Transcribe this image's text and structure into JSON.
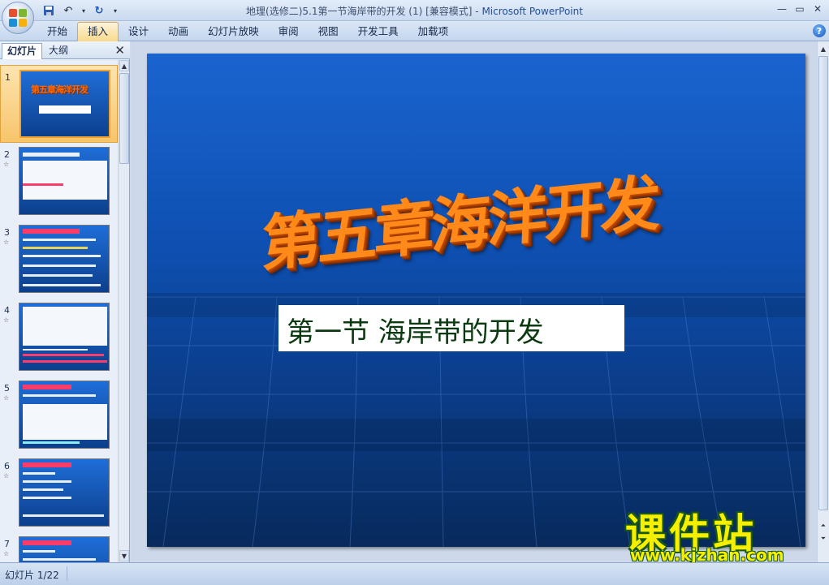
{
  "window": {
    "title": "地理(选修二)5.1第一节海岸带的开发 (1) [兼容模式] - ",
    "app_name": "Microsoft PowerPoint"
  },
  "qat": {
    "save_icon": "save-icon",
    "undo_icon": "undo-icon",
    "redo_icon": "redo-icon"
  },
  "ribbon": {
    "tabs": [
      {
        "label": "开始"
      },
      {
        "label": "插入",
        "active": true
      },
      {
        "label": "设计"
      },
      {
        "label": "动画"
      },
      {
        "label": "幻灯片放映"
      },
      {
        "label": "审阅"
      },
      {
        "label": "视图"
      },
      {
        "label": "开发工具"
      },
      {
        "label": "加载项"
      }
    ],
    "help": "?"
  },
  "left_panel": {
    "tab_slides": "幻灯片",
    "tab_outline": "大纲",
    "close": "✕",
    "thumbnails": [
      {
        "num": "1",
        "title": "第五章海洋开发",
        "selected": true
      },
      {
        "num": "2"
      },
      {
        "num": "3"
      },
      {
        "num": "4"
      },
      {
        "num": "5"
      },
      {
        "num": "6"
      },
      {
        "num": "7"
      }
    ]
  },
  "slide": {
    "title": "第五章海洋开发",
    "subtitle": "第一节  海岸带的开发"
  },
  "watermark": {
    "name": "课件站",
    "url": "www.kjzhan.com"
  },
  "status": {
    "slide_counter": "幻灯片 1/22"
  }
}
